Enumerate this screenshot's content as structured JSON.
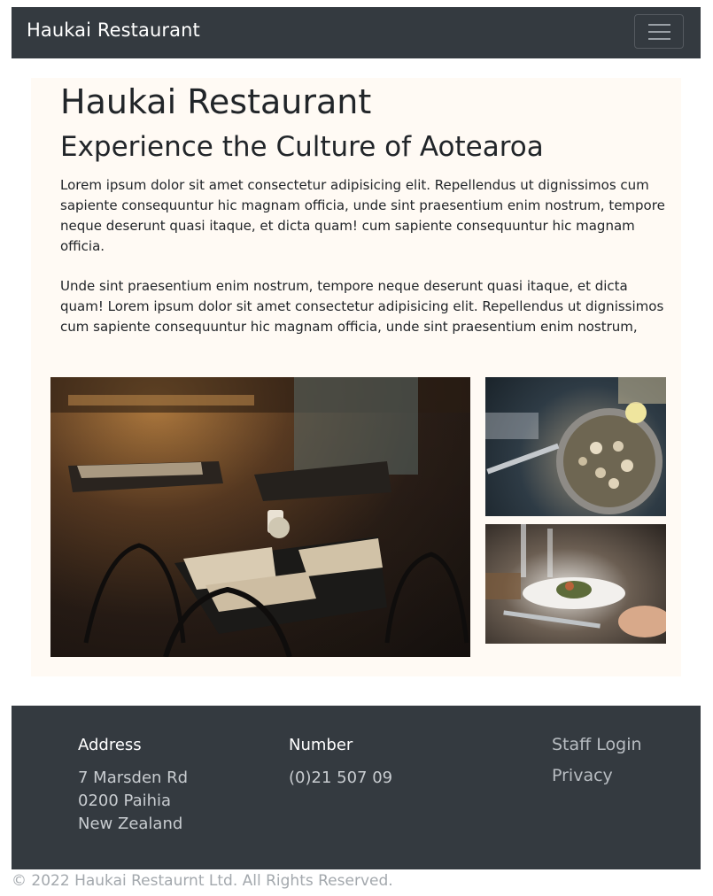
{
  "navbar": {
    "brand": "Haukai Restaurant",
    "toggler_icon": "menu-icon"
  },
  "hero": {
    "title": "Haukai Restaurant",
    "subtitle": "Experience the Culture of Aotearoa",
    "paragraphs": [
      "Lorem ipsum dolor sit amet consectetur adipisicing elit. Repellendus ut dignissimos cum sapiente consequuntur hic magnam officia, unde sint praesentium enim nostrum, tempore neque deserunt quasi itaque, et dicta quam! cum sapiente consequuntur hic magnam officia.",
      "Unde sint praesentium enim nostrum, tempore neque deserunt quasi itaque, et dicta quam! Lorem ipsum dolor sit amet consectetur adipisicing elit. Repellendus ut dignissimos cum sapiente consequuntur hic magnam officia, unde sint praesentium enim nostrum,"
    ]
  },
  "footer": {
    "address_heading": "Address",
    "address_lines": [
      "7 Marsden Rd",
      "0200 Paihia",
      "New Zealand"
    ],
    "number_heading": "Number",
    "number": "(0)21 507 09",
    "links": [
      "Staff Login",
      "Privacy"
    ]
  },
  "copyright": "© 2022 Haukai Restaurnt Ltd. All Rights Reserved.",
  "colors": {
    "navbar_bg": "#343a40",
    "hero_bg": "#fffaf4"
  }
}
